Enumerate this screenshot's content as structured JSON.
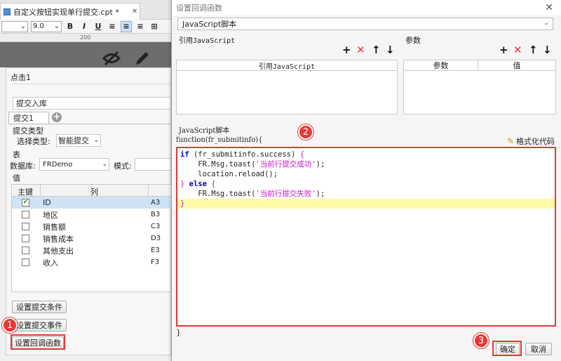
{
  "editor": {
    "tab_title": "自定义按钮实现单行提交.cpt *",
    "tab_close": "✕",
    "font_size": "9.0",
    "ruler_mark": "200",
    "event_label": "点击1",
    "submit_name": "提交入库",
    "sub_tab": "提交1",
    "submit_type_title": "提交类型",
    "choose_type_label": "选择类型:",
    "choose_type_value": "智能提交",
    "table_title": "表",
    "database_label": "数据库:",
    "database_value": "FRDemo",
    "mode_label": "模式:",
    "value_title": "值",
    "value_headers": [
      "主键",
      "列"
    ],
    "value_rows": [
      {
        "checked": true,
        "col": "ID",
        "cell": "A3"
      },
      {
        "checked": false,
        "col": "地区",
        "cell": "B3"
      },
      {
        "checked": false,
        "col": "销售额",
        "cell": "C3"
      },
      {
        "checked": false,
        "col": "销售成本",
        "cell": "D3"
      },
      {
        "checked": false,
        "col": "其他支出",
        "cell": "E3"
      },
      {
        "checked": false,
        "col": "收入",
        "cell": "F3"
      }
    ],
    "btn_submit_condition": "设置提交条件",
    "btn_submit_event": "设置提交事件",
    "btn_callback": "设置回调函数"
  },
  "dialog": {
    "title": "设置回调函数",
    "close": "✕",
    "type_value": "JavaScript脚本",
    "ref_js_label": "引用JavaScript",
    "params_label": "参数",
    "ref_js_column": "引用JavaScript",
    "param_columns": [
      "参数",
      "值"
    ],
    "script_label": "JavaScript脚本",
    "func_header": "function(fr_submitinfo){",
    "format_code": "格式化代码",
    "code_lines": [
      {
        "parts": [
          {
            "t": "if",
            "c": "kw"
          },
          {
            "t": " (fr_submitinfo.success) ",
            "c": ""
          },
          {
            "t": "{",
            "c": "str"
          }
        ]
      },
      {
        "parts": [
          {
            "t": "    FR.Msg.toast(",
            "c": ""
          },
          {
            "t": "'当前行提交成功'",
            "c": "str"
          },
          {
            "t": ");",
            "c": ""
          }
        ]
      },
      {
        "parts": [
          {
            "t": "    location.reload();",
            "c": ""
          }
        ]
      },
      {
        "parts": [
          {
            "t": "} ",
            "c": "str"
          },
          {
            "t": "else",
            "c": "kw"
          },
          {
            "t": " {",
            "c": "str"
          }
        ]
      },
      {
        "parts": [
          {
            "t": "    FR.Msg.toast(",
            "c": ""
          },
          {
            "t": "'当前行提交失败'",
            "c": "str"
          },
          {
            "t": ");",
            "c": ""
          }
        ]
      },
      {
        "parts": [
          {
            "t": "}",
            "c": "str"
          }
        ]
      }
    ],
    "func_footer": "}",
    "ok": "确定",
    "cancel": "取消"
  },
  "badges": [
    "1",
    "2",
    "3"
  ],
  "icons": {
    "add": "+",
    "delete": "✕",
    "up": "↑",
    "down": "↓"
  },
  "colors": {
    "accent_red": "#e53935",
    "keyword": "#0000c8",
    "string": "#c41ac4",
    "highlight": "#fffaa8"
  }
}
